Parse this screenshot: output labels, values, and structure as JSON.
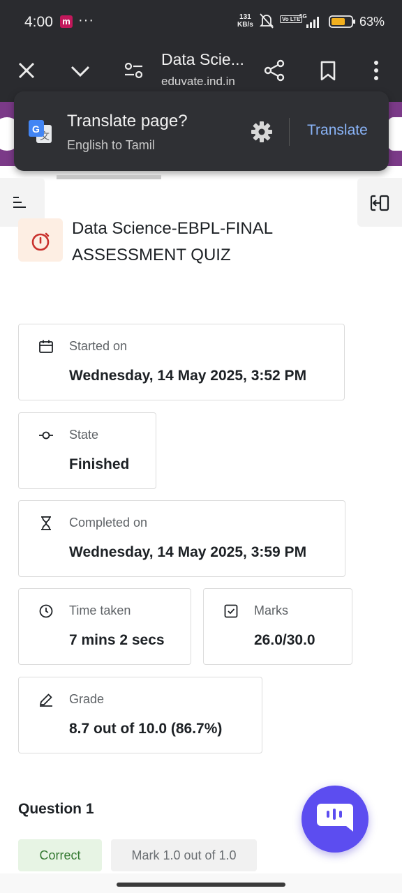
{
  "status_bar": {
    "time": "4:00",
    "app_badge": "m",
    "more": "···",
    "net_speed_value": "131",
    "net_speed_unit": "KB/s",
    "volte": "Vo LTE",
    "network": "5G",
    "battery": "63%",
    "battery_color": "#f2b01e"
  },
  "toolbar": {
    "title": "Data Scie...",
    "url": "eduvate.ind.in"
  },
  "translate_popup": {
    "title": "Translate page?",
    "subtitle": "English to Tamil",
    "button": "Translate",
    "button_color": "#8ab4f8"
  },
  "quiz": {
    "title": "Data Science-EBPL-FINAL ASSESSMENT QUIZ",
    "icon": "stopwatch-icon",
    "icon_color": "#c9302c"
  },
  "summary": {
    "started_label": "Started on",
    "started_value": "Wednesday, 14 May 2025, 3:52 PM",
    "state_label": "State",
    "state_value": "Finished",
    "completed_label": "Completed on",
    "completed_value": "Wednesday, 14 May 2025, 3:59 PM",
    "time_label": "Time taken",
    "time_value": "7 mins 2 secs",
    "marks_label": "Marks",
    "marks_value": "26.0/30.0",
    "grade_label": "Grade",
    "grade_value": "8.7 out of 10.0 (86.7%)"
  },
  "question": {
    "title": "Question 1",
    "status": "Correct",
    "mark": "Mark 1.0 out of 1.0"
  },
  "colors": {
    "header_purple": "#7b3a88",
    "chat_fab": "#5c4df0",
    "correct_bg": "#e7f4e4",
    "correct_text": "#357a32"
  }
}
